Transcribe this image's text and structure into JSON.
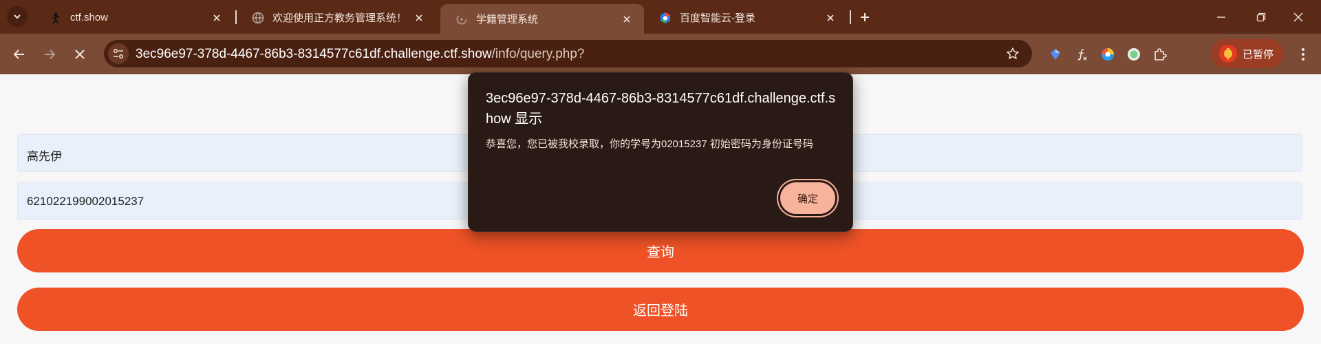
{
  "browser": {
    "tabs": [
      {
        "title": "ctf.show",
        "active": false
      },
      {
        "title": "欢迎使用正方教务管理系统！请",
        "active": false
      },
      {
        "title": "学籍管理系统",
        "active": true
      },
      {
        "title": "百度智能云-登录",
        "active": false
      }
    ],
    "url": {
      "host": "3ec96e97-378d-4467-86b3-8314577c61df.challenge.ctf.show",
      "path": "/info/query.php?"
    },
    "profile_status": "已暂停",
    "colors": {
      "frame": "#5a2a17",
      "toolbar": "#7b4b35",
      "omnibox": "#4a2011"
    }
  },
  "form": {
    "name_value": "高先伊",
    "id_value": "621022199002015237",
    "query_button": "查询",
    "back_button": "返回登陆",
    "accent": "#ee5226"
  },
  "dialog": {
    "title": "3ec96e97-378d-4467-86b3-8314577c61df.challenge.ctf.show 显示",
    "message": "恭喜您，您已被我校录取，你的学号为02015237 初始密码为身份证号码",
    "ok_button": "确定"
  }
}
